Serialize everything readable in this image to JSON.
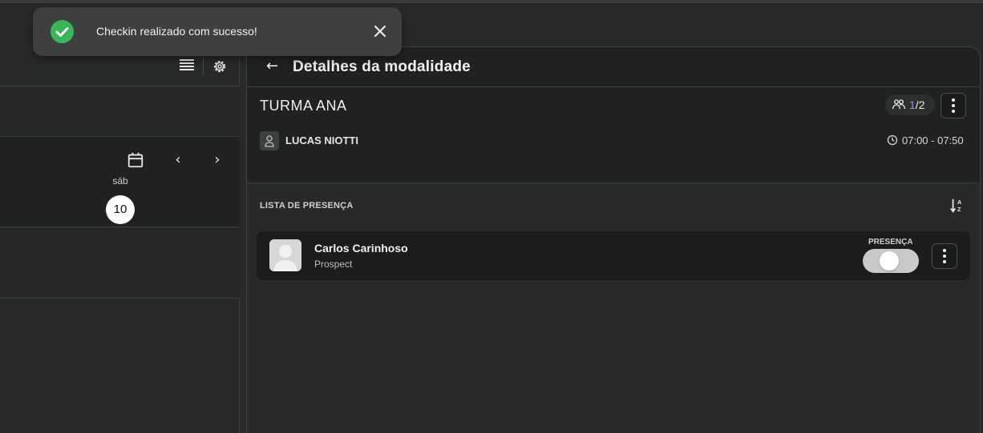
{
  "toast": {
    "message": "Checkin realizado com sucesso!",
    "icon": "check-circle-icon",
    "close_icon": "close-icon",
    "color": "#3cb55a"
  },
  "left_panel": {
    "toolbar_icons": [
      "list-view-icon",
      "gear-icon"
    ],
    "calendar": {
      "icon": "calendar-icon",
      "prev_icon": "chevron-left-icon",
      "next_icon": "chevron-right-icon",
      "day_label": "sáb",
      "day_number": "10"
    }
  },
  "detail": {
    "title": "Detalhes da modalidade",
    "back_icon": "arrow-left-icon",
    "class_name": "TURMA ANA",
    "capacity": {
      "current": "1",
      "separator": "/",
      "total": "2",
      "icon": "group-icon"
    },
    "teacher": {
      "name": "LUCAS NIOTTI",
      "icon": "person-icon"
    },
    "time_range": "07:00 - 07:50",
    "attendance": {
      "title": "LISTA DE PRESENÇA",
      "sort_icon": "sort-alpha-icon",
      "presence_label": "PRESENÇA",
      "students": [
        {
          "name": "Carlos Carinhoso",
          "type": "Prospect",
          "present": false
        }
      ]
    }
  },
  "colors": {
    "accent": "#8e8cff",
    "success": "#3cb55a",
    "background": "#272a27",
    "panel": "#1f221f"
  }
}
